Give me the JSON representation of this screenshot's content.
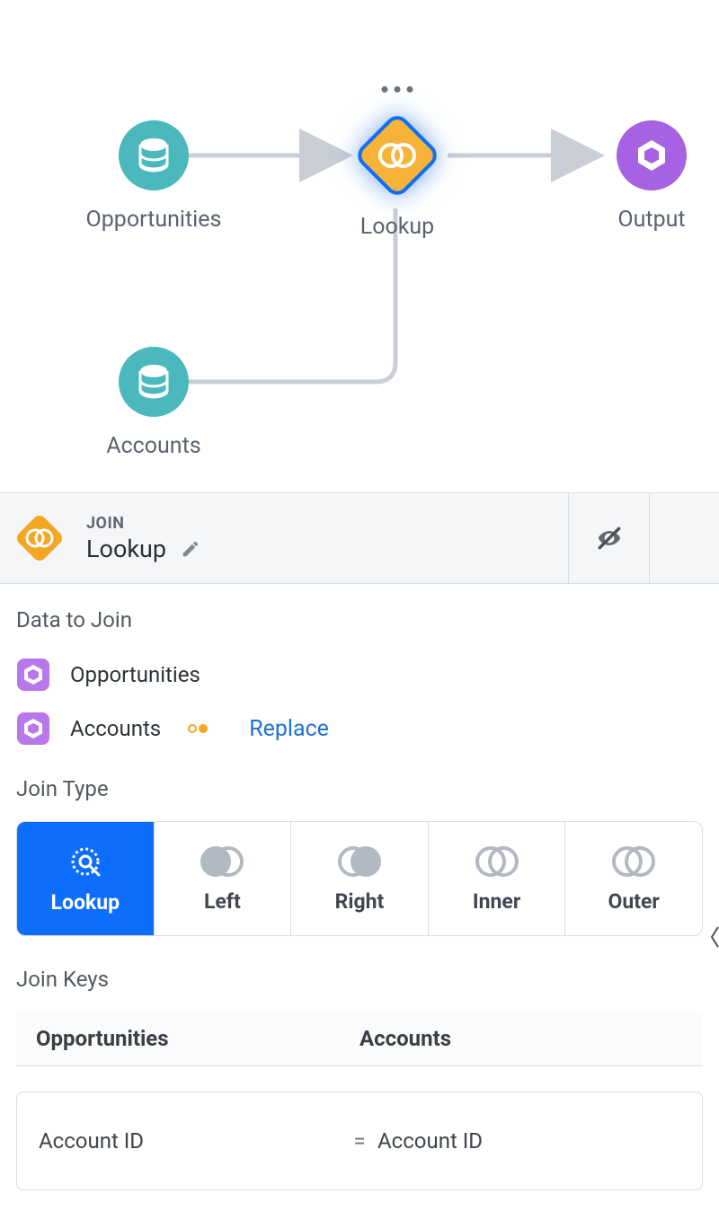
{
  "canvas": {
    "nodes": {
      "opportunities": {
        "label": "Opportunities",
        "color": "#4ab8bd"
      },
      "accounts": {
        "label": "Accounts",
        "color": "#4ab8bd"
      },
      "lookup": {
        "label": "Lookup",
        "color": "#f5a623"
      },
      "output": {
        "label": "Output",
        "color": "#a662e2"
      }
    }
  },
  "panel": {
    "kicker": "JOIN",
    "name": "Lookup",
    "sections": {
      "data_to_join": {
        "title": "Data to Join",
        "items": [
          {
            "name": "Opportunities"
          },
          {
            "name": "Accounts"
          }
        ],
        "replace_label": "Replace"
      },
      "join_type": {
        "title": "Join Type",
        "options": [
          "Lookup",
          "Left",
          "Right",
          "Inner",
          "Outer"
        ],
        "selected": "Lookup"
      },
      "join_keys": {
        "title": "Join Keys",
        "headers": {
          "left": "Opportunities",
          "right": "Accounts"
        },
        "rows": [
          {
            "left": "Account ID",
            "op": "=",
            "right": "Account ID"
          }
        ]
      }
    }
  }
}
